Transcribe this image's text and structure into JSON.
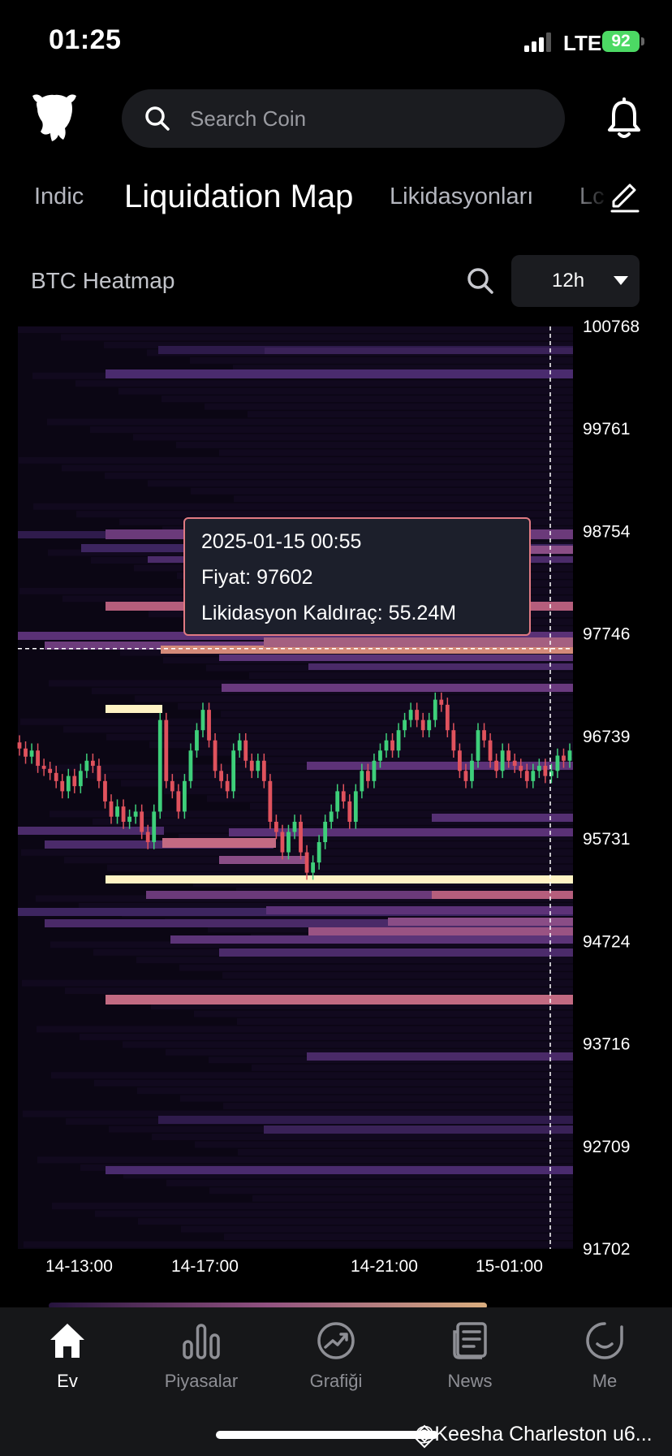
{
  "status_bar": {
    "time": "01:25",
    "network": "LTE",
    "battery": "92"
  },
  "header": {
    "search_placeholder": "Search Coin"
  },
  "tabs": [
    {
      "label": "Indic"
    },
    {
      "label": "Liquidation Map"
    },
    {
      "label": "Likidasyonları"
    },
    {
      "label": "Lc"
    }
  ],
  "heatmap": {
    "title": "BTC Heatmap",
    "interval": "12h",
    "tooltip": {
      "time": "2025-01-15 00:55",
      "price": "Fiyat: 97602",
      "leverage": "Likidasyon Kaldıraç: 55.24M"
    }
  },
  "chart_data": {
    "type": "heatmap",
    "y_ticks": [
      100768,
      99761,
      98754,
      97746,
      96739,
      95731,
      94724,
      93716,
      92709,
      91702
    ],
    "x_ticks": [
      "14-13:00",
      "14-17:00",
      "14-21:00",
      "15-01:00"
    ],
    "ylim": [
      91702,
      100768
    ],
    "crosshair_price": 97602,
    "colors": {
      "low": "#2a1744",
      "mid": "#a25b8f",
      "high": "#fff3c4",
      "up": "#3ecf7a",
      "down": "#e0525d"
    },
    "close_prices": [
      96620,
      96540,
      96600,
      96450,
      96420,
      96380,
      96300,
      96200,
      96350,
      96250,
      96400,
      96500,
      96450,
      96300,
      96100,
      95950,
      96050,
      95900,
      95950,
      96000,
      95800,
      95700,
      96000,
      96900,
      96300,
      96200,
      96000,
      96300,
      96600,
      96800,
      97000,
      96700,
      96400,
      96300,
      96200,
      96600,
      96700,
      96500,
      96400,
      96500,
      96300,
      95900,
      95800,
      95600,
      95800,
      95900,
      95600,
      95400,
      95500,
      95700,
      95900,
      96000,
      96200,
      96100,
      95900,
      96200,
      96400,
      96300,
      96500,
      96600,
      96700,
      96600,
      96800,
      96900,
      97000,
      96900,
      96800,
      96900,
      97100,
      97050,
      96800,
      96600,
      96400,
      96300,
      96500,
      96800,
      96700,
      96500,
      96400,
      96600,
      96500,
      96450,
      96400,
      96300,
      96400,
      96450,
      96350,
      96400,
      96550,
      96500,
      96600
    ]
  },
  "bottom_nav": [
    {
      "label": "Ev",
      "icon": "home-icon"
    },
    {
      "label": "Piyasalar",
      "icon": "bar-chart-icon"
    },
    {
      "label": "Grafiği",
      "icon": "trend-icon"
    },
    {
      "label": "News",
      "icon": "news-icon"
    },
    {
      "label": "Me",
      "icon": "smile-icon"
    }
  ],
  "watermark": "@Keesha Charleston u6..."
}
